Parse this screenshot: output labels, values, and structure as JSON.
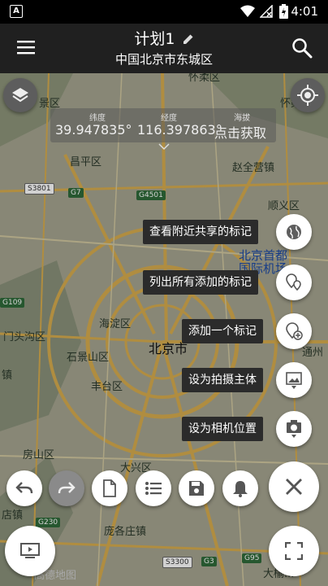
{
  "status_bar": {
    "time": "4:01",
    "icons": [
      "notification-a-icon",
      "wifi-icon",
      "no-signal-icon",
      "battery-charging-icon"
    ]
  },
  "header": {
    "title": "计划1",
    "subtitle": "中国北京市东城区",
    "menu_icon": "hamburger-icon",
    "edit_icon": "pencil-icon",
    "search_icon": "search-icon"
  },
  "coords": {
    "lat_label": "纬度",
    "lat": "39.947835°",
    "lng_label": "经度",
    "lng": "116.397863°",
    "alt_label": "海拔",
    "get": "点击获取"
  },
  "map_labels": {
    "huairou_ne": "怀柔区",
    "yanqing": "景区",
    "pinggu_top": "怀柔区",
    "changping": "昌平区",
    "zhaoquanying": "赵全营镇",
    "shunyi": "顺义区",
    "airport": "北京首都国际机场",
    "haidian": "海淀区",
    "mentougou": "门头沟区",
    "shijingshan": "石景山区",
    "beijing": "北京市",
    "fengtai": "丰台区",
    "fangshan": "房山区",
    "daxing": "大兴区",
    "pangezhuang": "庞各庄镇",
    "tongzhou": "通州",
    "zhen1": "镇",
    "zhen2": "店镇",
    "gaode": "高德地图",
    "dayu": "大榆..."
  },
  "road_shields": {
    "s3801": "S3801",
    "g7": "G7",
    "g4501": "G4501",
    "g109": "G109",
    "g230": "G230",
    "s3300": "S3300",
    "g3": "G3",
    "g95": "G95"
  },
  "fab_menu": [
    {
      "label": "查看附近共享的标记",
      "icon": "globe-icon"
    },
    {
      "label": "列出所有添加的标记",
      "icon": "markers-list-icon"
    },
    {
      "label": "添加一个标记",
      "icon": "add-marker-icon"
    },
    {
      "label": "设为拍摄主体",
      "icon": "subject-photo-icon"
    },
    {
      "label": "设为相机位置",
      "icon": "camera-position-icon"
    }
  ],
  "toolbar": {
    "undo": "undo-icon",
    "redo": "redo-icon",
    "file": "file-icon",
    "list": "list-icon",
    "save": "save-icon",
    "bell": "bell-icon",
    "close": "close-icon"
  },
  "bottom": {
    "screen": "screen-icon",
    "fullscreen": "fullscreen-icon"
  },
  "map_controls": {
    "layers": "layers-icon",
    "locate": "locate-icon"
  }
}
